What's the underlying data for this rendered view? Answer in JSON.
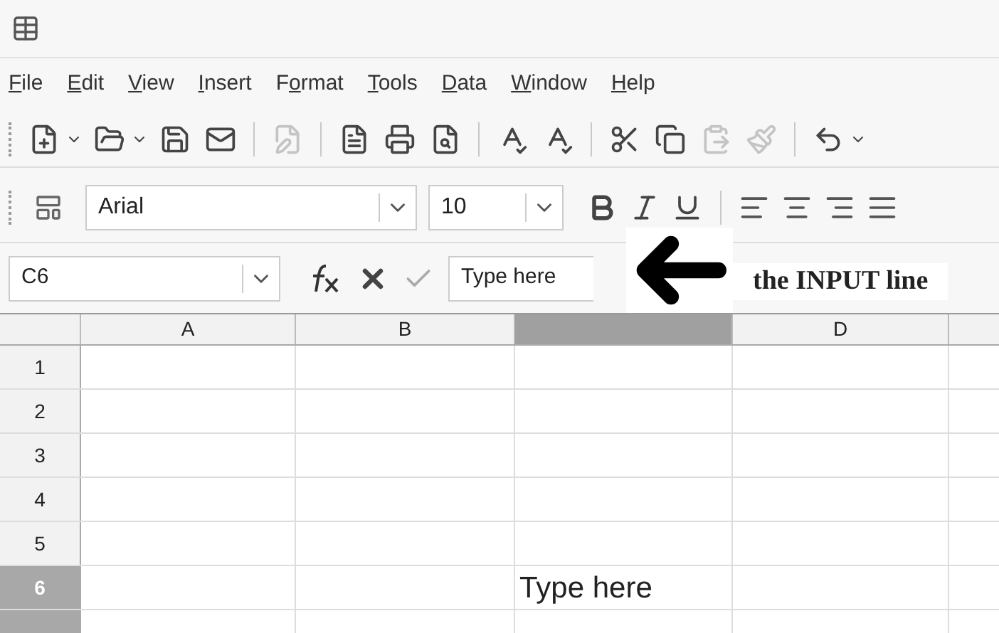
{
  "menu": [
    {
      "mnemonic": "F",
      "suffix": "ile"
    },
    {
      "mnemonic": "E",
      "suffix": "dit"
    },
    {
      "mnemonic": "V",
      "suffix": "iew"
    },
    {
      "mnemonic": "I",
      "suffix": "nsert"
    },
    {
      "prefix": "F",
      "mnemonic": "o",
      "suffix": "rmat"
    },
    {
      "mnemonic": "T",
      "suffix": "ools"
    },
    {
      "mnemonic": "D",
      "suffix": "ata"
    },
    {
      "mnemonic": "W",
      "suffix": "indow"
    },
    {
      "mnemonic": "H",
      "suffix": "elp"
    }
  ],
  "standard_toolbar": [
    {
      "disabled": false
    },
    {
      "disabled": false
    },
    {
      "disabled": false
    },
    {
      "disabled": false
    },
    {
      "disabled": true
    },
    {
      "disabled": false
    },
    {
      "disabled": false
    },
    {
      "disabled": false
    },
    {
      "disabled": false
    },
    {
      "disabled": false
    },
    {
      "disabled": false
    },
    {
      "disabled": false
    },
    {
      "disabled": true
    },
    {
      "disabled": true
    },
    {
      "disabled": false
    }
  ],
  "formatting_toolbar": {
    "font_name": "Arial",
    "font_size": "10"
  },
  "formula_bar": {
    "name_box": "C6",
    "input": "Type here"
  },
  "annotation": {
    "text": "the INPUT line"
  },
  "sheet": {
    "columns": [
      {
        "label": "A",
        "selected": false
      },
      {
        "label": "B",
        "selected": false
      },
      {
        "selected": true
      },
      {
        "label": "D",
        "selected": false
      }
    ],
    "rows": [
      {
        "label": "1",
        "selected": false,
        "cells": [
          "",
          "",
          "",
          ""
        ]
      },
      {
        "label": "2",
        "selected": false,
        "cells": [
          "",
          "",
          "",
          ""
        ]
      },
      {
        "label": "3",
        "selected": false,
        "cells": [
          "",
          "",
          "",
          ""
        ]
      },
      {
        "label": "4",
        "selected": false,
        "cells": [
          "",
          "",
          "",
          ""
        ]
      },
      {
        "label": "5",
        "selected": false,
        "cells": [
          "",
          "",
          "",
          ""
        ]
      },
      {
        "label": "6",
        "selected": true,
        "cells": [
          "",
          "",
          "Type here",
          ""
        ]
      }
    ]
  }
}
